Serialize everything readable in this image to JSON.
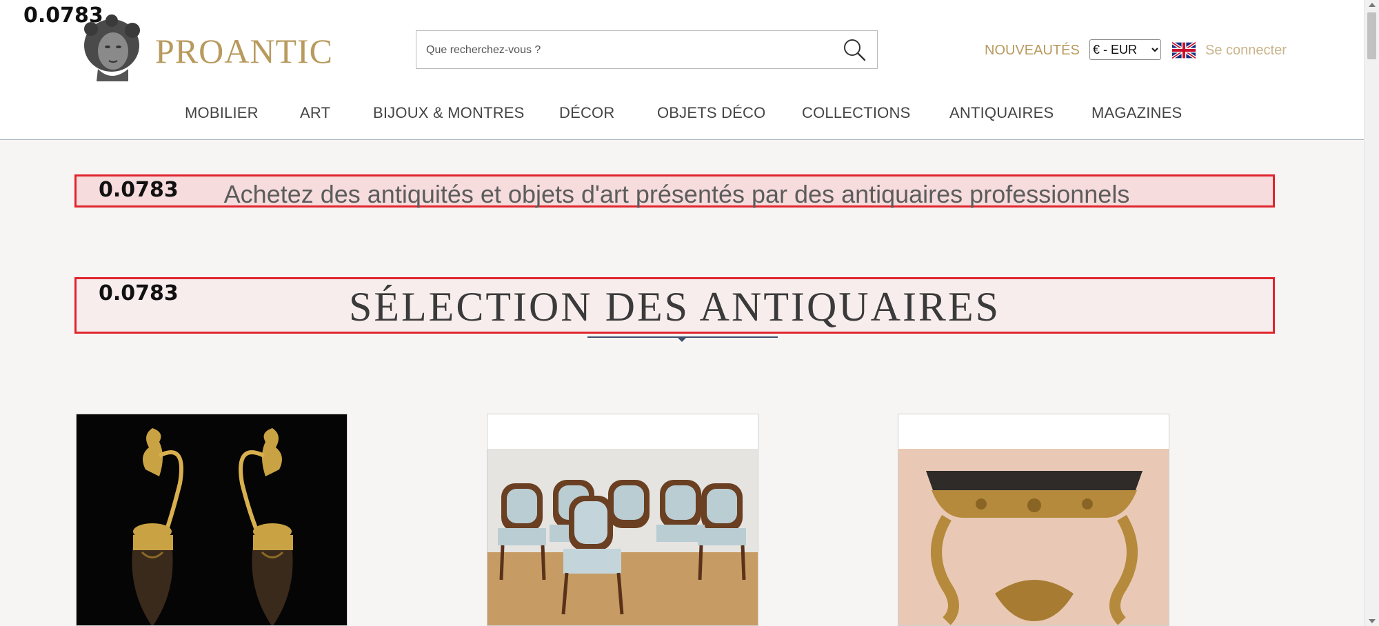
{
  "overlay": {
    "score": "0.0783"
  },
  "header": {
    "logo_text": "PROANTIC",
    "search": {
      "placeholder": "Que recherchez-vous ?",
      "value": ""
    },
    "nouveautes": "NOUVEAUTÉS",
    "currency": {
      "selected": "€ - EUR"
    },
    "language_icon": "uk-flag-icon",
    "login": "Se connecter",
    "accent_color": "#b89a5e"
  },
  "nav": {
    "items": [
      {
        "label": "MOBILIER"
      },
      {
        "label": "ART"
      },
      {
        "label": "BIJOUX & MONTRES"
      },
      {
        "label": "DÉCOR"
      },
      {
        "label": "OBJETS DÉCO"
      },
      {
        "label": "COLLECTIONS"
      },
      {
        "label": "ANTIQUAIRES"
      },
      {
        "label": "MAGAZINES"
      }
    ]
  },
  "main": {
    "tagline": "Achetez des antiquités et objets d'art présentés par des antiquaires professionnels",
    "section_title": "SÉLECTION DES ANTIQUAIRES",
    "highlight_color": "#e0242e",
    "products": [
      {
        "image": "gilt-bronze-ewers"
      },
      {
        "image": "set-of-louis-xv-chairs"
      },
      {
        "image": "carved-giltwood-console-table"
      }
    ]
  }
}
